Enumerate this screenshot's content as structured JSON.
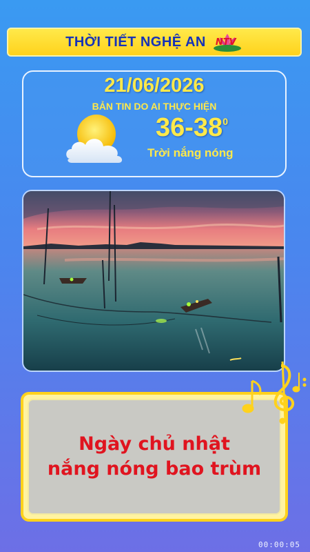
{
  "header": {
    "title": "THỜI TIẾT NGHỆ AN",
    "logo_text": "NTV"
  },
  "weather": {
    "date": "21/06/2026",
    "subtitle": "BẢN TIN DO AI THỰC HIỆN",
    "temperature": "36-38",
    "degree": "0",
    "condition": "Trời nắng nóng",
    "icon": "sun-behind-cloud-icon"
  },
  "photo": {
    "icon": "sunset-lagoon-fishing-boats-image"
  },
  "caption": {
    "line1": "Ngày chủ nhật",
    "line2": "nắng nóng bao trùm"
  },
  "decor": {
    "icon": "music-notes-icon"
  },
  "player": {
    "timecode": "00:00:05"
  },
  "colors": {
    "header_bg": "#ffd21c",
    "header_text": "#1632b8",
    "accent_yellow": "#ffe94a",
    "caption_red": "#e0141f",
    "background_top": "#3a9af2",
    "background_bottom": "#6d6fe6"
  }
}
